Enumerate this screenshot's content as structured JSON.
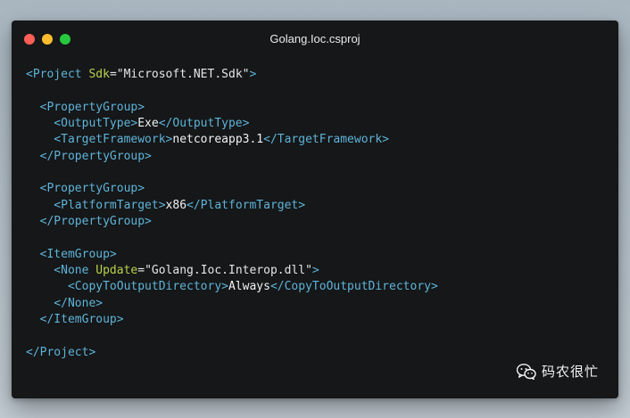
{
  "window": {
    "title": "Golang.Ioc.csproj",
    "controls": [
      "close",
      "minimize",
      "zoom"
    ]
  },
  "code_lines": [
    [
      {
        "t": "tag",
        "v": "<Project "
      },
      {
        "t": "attr",
        "v": "Sdk"
      },
      {
        "t": "val",
        "v": "="
      },
      {
        "t": "val",
        "v": "\"Microsoft.NET.Sdk\""
      },
      {
        "t": "tag",
        "v": ">"
      }
    ],
    [],
    [
      {
        "t": "tag",
        "v": "  <PropertyGroup>"
      }
    ],
    [
      {
        "t": "tag",
        "v": "    <OutputType>"
      },
      {
        "t": "txt",
        "v": "Exe"
      },
      {
        "t": "tag",
        "v": "</OutputType>"
      }
    ],
    [
      {
        "t": "tag",
        "v": "    <TargetFramework>"
      },
      {
        "t": "txt",
        "v": "netcoreapp3.1"
      },
      {
        "t": "tag",
        "v": "</TargetFramework>"
      }
    ],
    [
      {
        "t": "tag",
        "v": "  </PropertyGroup>"
      }
    ],
    [],
    [
      {
        "t": "tag",
        "v": "  <PropertyGroup>"
      }
    ],
    [
      {
        "t": "tag",
        "v": "    <PlatformTarget>"
      },
      {
        "t": "txt",
        "v": "x86"
      },
      {
        "t": "tag",
        "v": "</PlatformTarget>"
      }
    ],
    [
      {
        "t": "tag",
        "v": "  </PropertyGroup>"
      }
    ],
    [],
    [
      {
        "t": "tag",
        "v": "  <ItemGroup>"
      }
    ],
    [
      {
        "t": "tag",
        "v": "    <None "
      },
      {
        "t": "attr",
        "v": "Update"
      },
      {
        "t": "val",
        "v": "="
      },
      {
        "t": "val",
        "v": "\"Golang.Ioc.Interop.dll\""
      },
      {
        "t": "tag",
        "v": ">"
      }
    ],
    [
      {
        "t": "tag",
        "v": "      <CopyToOutputDirectory>"
      },
      {
        "t": "txt",
        "v": "Always"
      },
      {
        "t": "tag",
        "v": "</CopyToOutputDirectory>"
      }
    ],
    [
      {
        "t": "tag",
        "v": "    </None>"
      }
    ],
    [
      {
        "t": "tag",
        "v": "  </ItemGroup>"
      }
    ],
    [],
    [
      {
        "t": "tag",
        "v": "</Project>"
      }
    ]
  ],
  "watermark": {
    "icon": "wechat-icon",
    "text": "码农很忙"
  },
  "colors": {
    "tag": "#5fb3d9",
    "attr": "#b7d24c",
    "text": "#e6e6e6",
    "window_bg": "#151718",
    "close": "#ff5f56",
    "minimize": "#ffbd2e",
    "zoom": "#27c93f"
  }
}
